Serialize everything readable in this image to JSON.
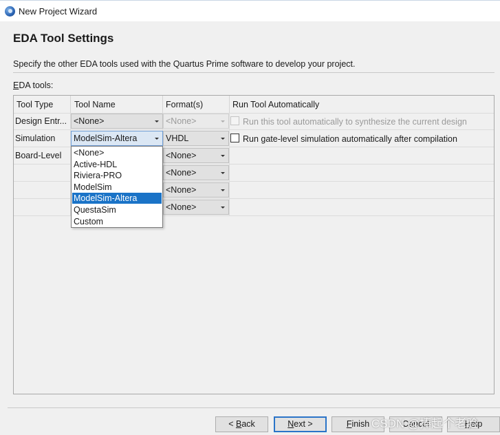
{
  "window": {
    "title": "New Project Wizard",
    "icon": "quartus-app-icon"
  },
  "page": {
    "title": "EDA Tool Settings",
    "description": "Specify the other EDA tools used with the Quartus Prime software to develop your project.",
    "section_label_mnemonic": "E",
    "section_label_rest": "DA tools:"
  },
  "table": {
    "headers": [
      "Tool Type",
      "Tool Name",
      "Format(s)",
      "Run Tool Automatically"
    ],
    "rows": [
      {
        "tool_type": "Design Entr...",
        "tool_name": "<None>",
        "format": "<None>",
        "run_label": "Run this tool automatically to synthesize the current design",
        "run_checked": false,
        "run_enabled": false
      },
      {
        "tool_type": "Simulation",
        "tool_name": "ModelSim-Altera",
        "format": "VHDL",
        "run_label": "Run gate-level simulation automatically after compilation",
        "run_checked": false,
        "run_enabled": true
      },
      {
        "tool_type": "Board-Level",
        "format": "<None>"
      },
      {
        "format": "<None>"
      },
      {
        "format": "<None>"
      },
      {
        "format": "<None>"
      }
    ]
  },
  "dropdown": {
    "options": [
      "<None>",
      "Active-HDL",
      "Riviera-PRO",
      "ModelSim",
      "ModelSim-Altera",
      "QuestaSim",
      "Custom"
    ],
    "selected": "ModelSim-Altera"
  },
  "buttons": {
    "back": {
      "prefix": "< ",
      "mnemonic": "B",
      "rest": "ack"
    },
    "next": {
      "mnemonic": "N",
      "rest": "ext >"
    },
    "finish": {
      "mnemonic": "F",
      "rest": "inish"
    },
    "cancel": "Cancel",
    "help": {
      "mnemonic": "H",
      "rest": "elp"
    }
  },
  "watermark": "CSDN @捧起个老脸",
  "colors": {
    "selection": "#1a73c7",
    "default_button_border": "#2a74c8"
  }
}
